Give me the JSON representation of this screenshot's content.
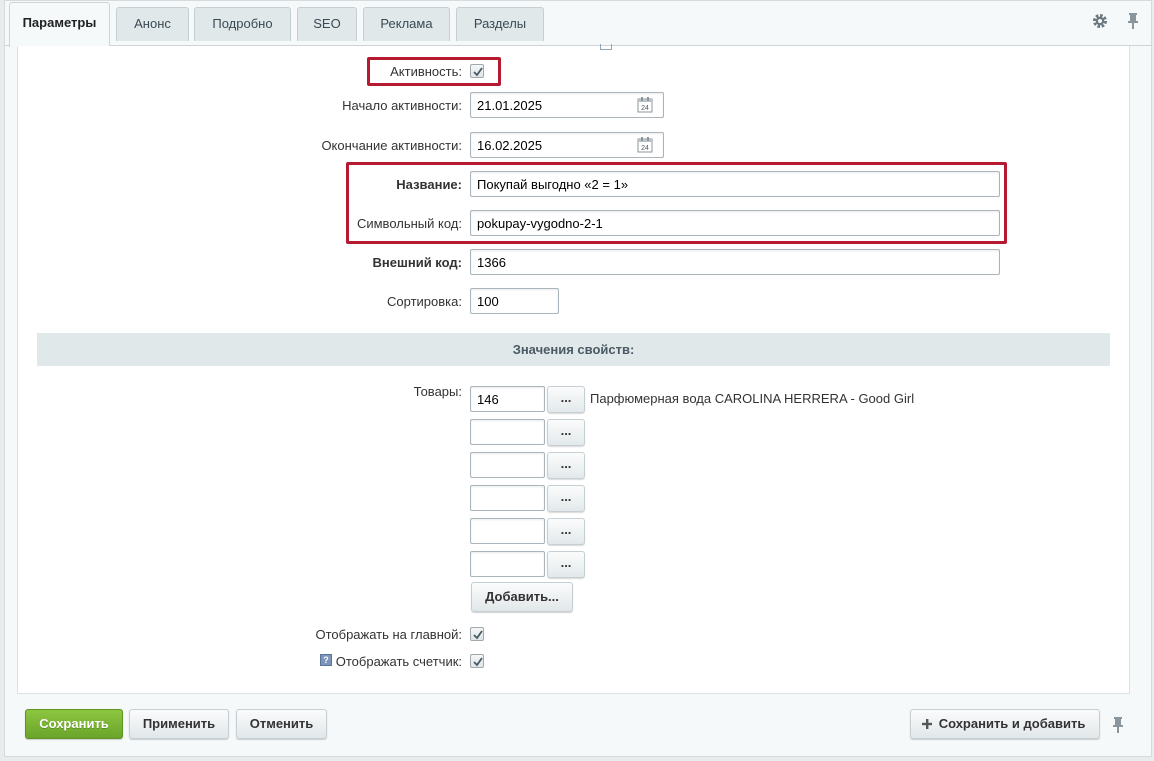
{
  "tabs": [
    "Параметры",
    "Анонс",
    "Подробно",
    "SEO",
    "Реклама",
    "Разделы"
  ],
  "icons": {
    "settings": "gear-icon",
    "pin": "pin-icon",
    "calendar": "calendar-icon"
  },
  "form": {
    "active_label": "Активность:",
    "active_checked": true,
    "start_label": "Начало активности:",
    "start_value": "21.01.2025",
    "end_label": "Окончание активности:",
    "end_value": "16.02.2025",
    "calendar_day": "24",
    "name_label": "Название:",
    "name_value": "Покупай выгодно «2 = 1»",
    "code_label": "Символьный код:",
    "code_value": "pokupay-vygodno-2-1",
    "ext_code_label": "Внешний код:",
    "ext_code_value": "1366",
    "sort_label": "Сортировка:",
    "sort_value": "100"
  },
  "properties": {
    "section_title": "Значения свойств:",
    "products_label": "Товары:",
    "products": [
      {
        "value": "146",
        "name": "Парфюмерная вода CAROLINA HERRERA - Good Girl"
      },
      {
        "value": "",
        "name": ""
      },
      {
        "value": "",
        "name": ""
      },
      {
        "value": "",
        "name": ""
      },
      {
        "value": "",
        "name": ""
      },
      {
        "value": "",
        "name": ""
      }
    ],
    "browse_label": "...",
    "add_label": "Добавить...",
    "show_main_label": "Отображать на главной:",
    "show_main_checked": true,
    "show_counter_label": "Отображать счетчик:",
    "show_counter_checked": true,
    "help_glyph": "?"
  },
  "footer": {
    "save": "Сохранить",
    "apply": "Применить",
    "cancel": "Отменить",
    "save_add": "Сохранить и добавить"
  },
  "colors": {
    "accent_green": "#74b031",
    "highlight_red": "#b51a31",
    "tab_bg": "#e0e8ea"
  }
}
